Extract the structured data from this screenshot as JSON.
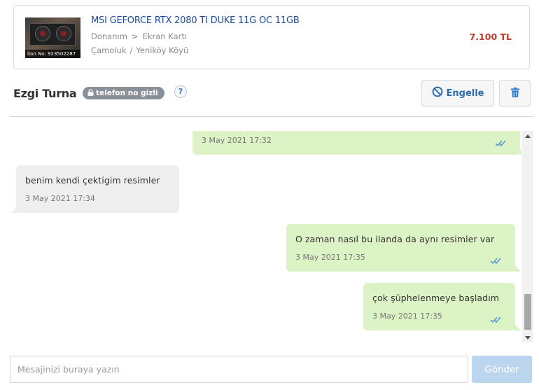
{
  "listing": {
    "title": "MSI GEFORCE RTX 2080 TI DUKE 11G OC 11GB",
    "category": "Donanım",
    "subcategory": "Ekran Kartı",
    "breadcrumb_separator": ">",
    "city": "Çamoluk",
    "district": "Yeniköy Köyü",
    "location_separator": "/",
    "price": "7.100 TL",
    "image_label": "İlan No: 923502287"
  },
  "header": {
    "user_name": "Ezgi Turna",
    "phone_badge": "telefon no gizli",
    "help_symbol": "?",
    "block_label": "Engelle",
    "icons": {
      "block": "ban-icon",
      "delete": "trash-icon",
      "lock": "lock-icon"
    },
    "accent_color": "#2b6cb0"
  },
  "messages": [
    {
      "direction": "sent",
      "text": "",
      "time": "3 May 2021 17:32",
      "read": true
    },
    {
      "direction": "received",
      "text": "benim kendi çektigim resimler",
      "time": "3 May 2021 17:34"
    },
    {
      "direction": "sent",
      "text": "O zaman nasıl bu ilanda da aynı resimler var",
      "time": "3 May 2021 17:35",
      "read": true
    },
    {
      "direction": "sent",
      "text": "çok şüphelenmeye başladım",
      "time": "3 May 2021 17:35",
      "read": true
    }
  ],
  "composer": {
    "placeholder": "Mesajinizi buraya yazın",
    "value": "",
    "send_label": "Gönder"
  }
}
